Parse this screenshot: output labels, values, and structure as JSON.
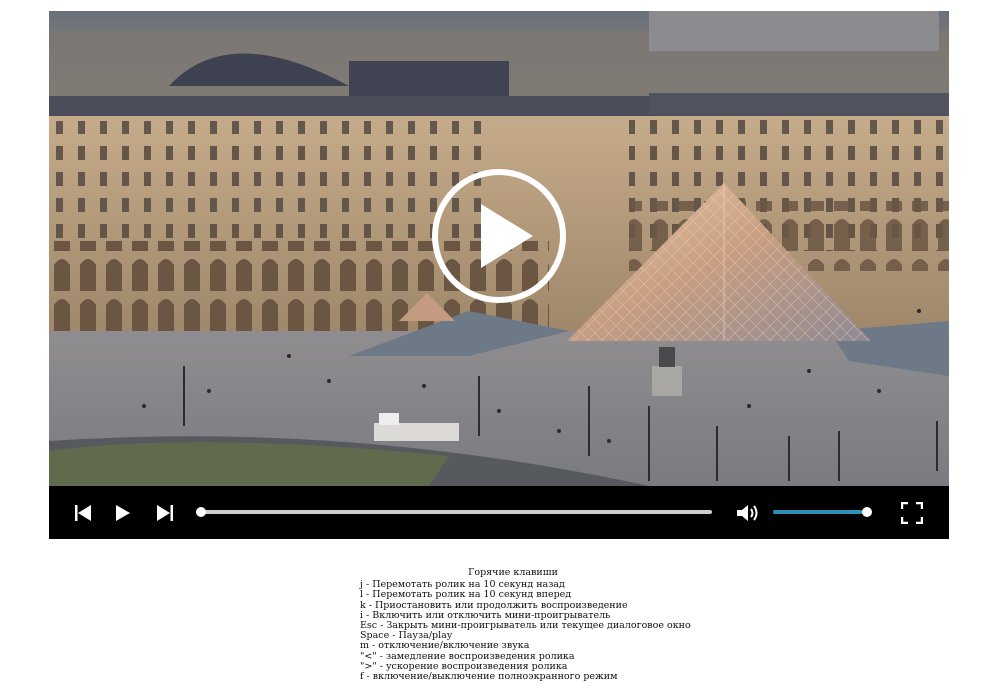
{
  "player": {
    "progress_fraction": 0.0,
    "volume_fraction": 1.0,
    "icons": {
      "prev": "skip-previous-icon",
      "play": "play-icon",
      "next": "skip-next-icon",
      "volume": "volume-icon",
      "fullscreen": "fullscreen-icon",
      "big_play": "big-play-icon"
    },
    "colors": {
      "controls_bg": "#000000",
      "progress_track": "#cfcfcf",
      "volume_fill": "#2e8fb8",
      "icon": "#ffffff"
    }
  },
  "hotkeys": {
    "title": "Горячие клавиши",
    "items": [
      "j - Перемотать ролик на 10 секунд назад",
      "l - Перемотать ролик на 10 секунд вперед",
      "k - Приостановить или продолжить воспроизведение",
      "i - Включить или отключить мини-проигрыватель",
      "Esc - Закрыть мини-проигрыватель или текущее диалоговое окно",
      "Space - Пауза/play",
      "m - отключение/включение звука",
      "\"<\" - замедление воспроизведения ролика",
      "\">\" - ускорение воспроизведения ролика",
      "f - включение/выключение полноэкранного режим"
    ]
  }
}
